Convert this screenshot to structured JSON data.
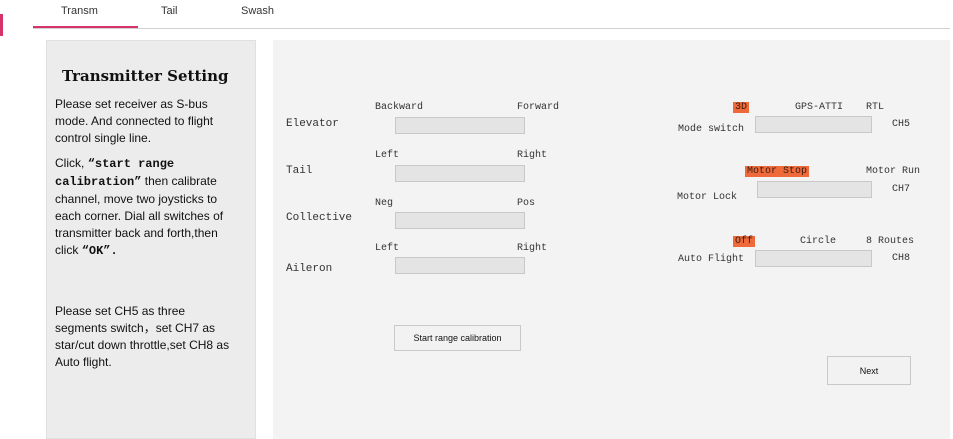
{
  "tabs": [
    {
      "label": "Transm",
      "active": true
    },
    {
      "label": "Tail",
      "active": false
    },
    {
      "label": "Swash",
      "active": false
    }
  ],
  "info": {
    "title": "Transmitter Setting",
    "p1": "Please set receiver as S-bus mode. And connected to flight control single line.",
    "p2_prefix": "Click,",
    "p2_code1": "“start range calibration”",
    "p2_mid": "then calibrate channel, move two joysticks to each corner. Dial all switches of transmitter back and forth,then click",
    "p2_code2": "“OK”.",
    "p3": "Please set CH5 as three segments switch，set CH7 as star/cut down throttle,set CH8 as Auto flight."
  },
  "channels": [
    {
      "name": "Elevator",
      "min_label": "Backward",
      "max_label": "Forward"
    },
    {
      "name": "Tail",
      "min_label": "Left",
      "max_label": "Right"
    },
    {
      "name": "Collective",
      "min_label": "Neg",
      "max_label": "Pos"
    },
    {
      "name": "Aileron",
      "min_label": "Left",
      "max_label": "Right"
    }
  ],
  "switches": [
    {
      "name": "Mode switch",
      "channel": "CH5",
      "options": [
        "3D",
        "GPS-ATTI",
        "RTL"
      ],
      "active_index": 0
    },
    {
      "name": "Motor Lock",
      "channel": "CH7",
      "options": [
        "Motor Stop",
        "Motor Run"
      ],
      "active_index": 0
    },
    {
      "name": "Auto Flight",
      "channel": "CH8",
      "options": [
        "Off",
        "Circle",
        "8 Routes"
      ],
      "active_index": 0
    }
  ],
  "buttons": {
    "calibrate": "Start range calibration",
    "next": "Next"
  },
  "colors": {
    "accent": "#d6336c",
    "highlight": "#ee6a3a"
  }
}
